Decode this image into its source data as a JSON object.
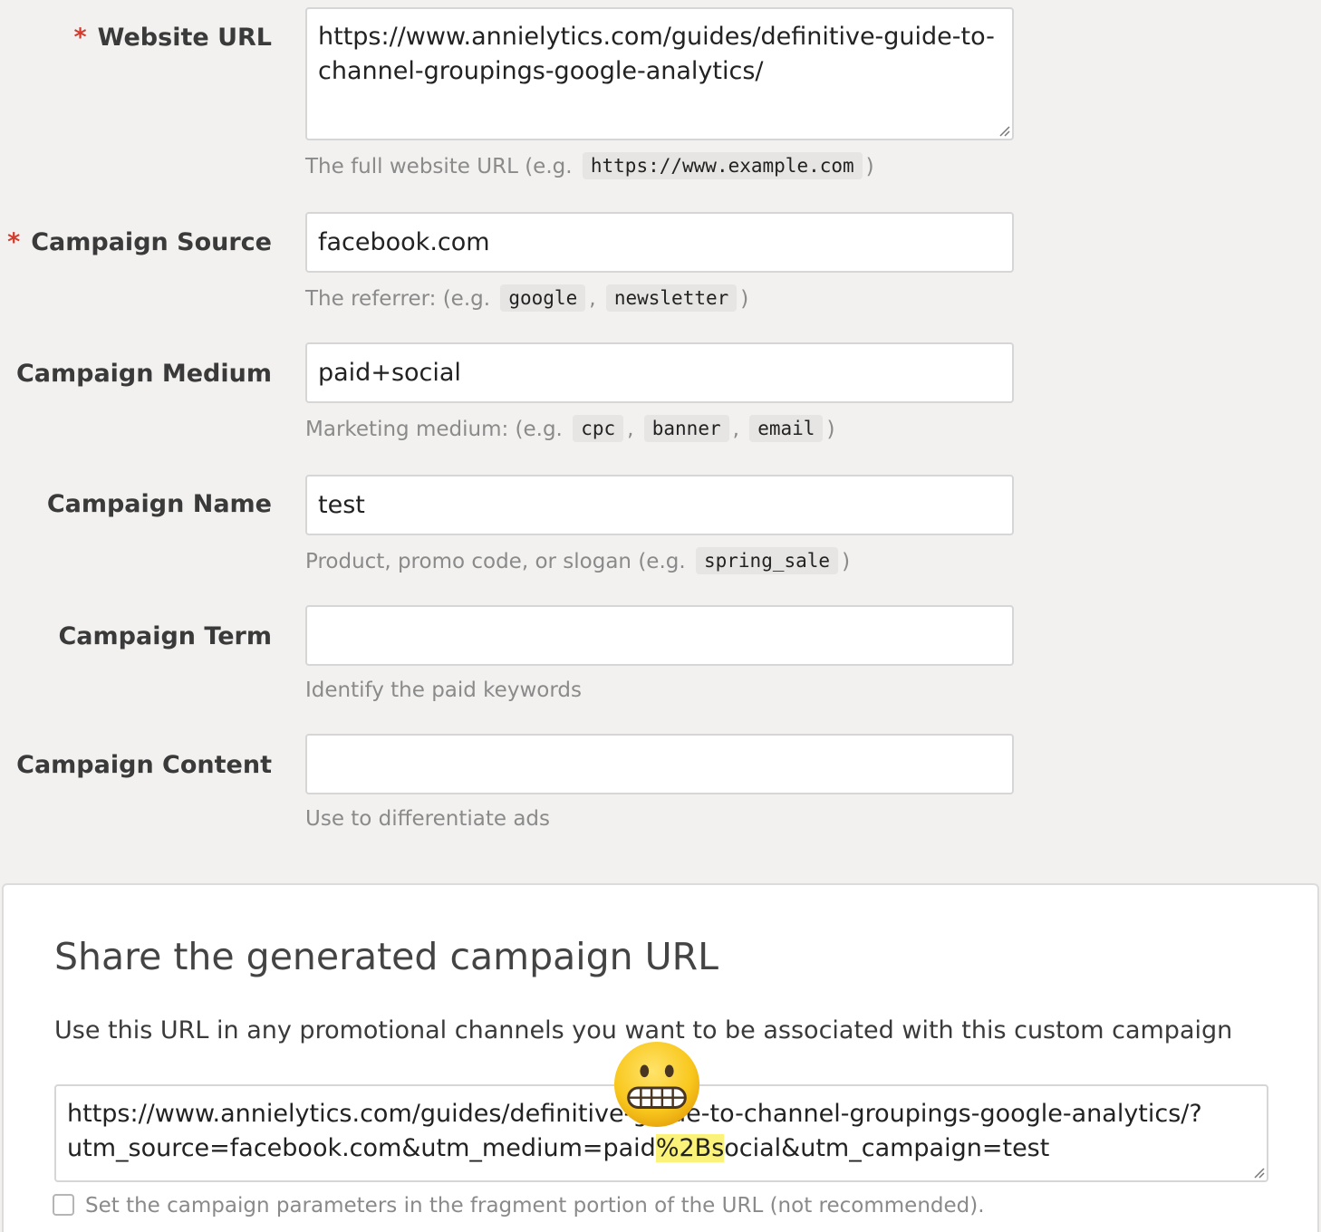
{
  "fields": {
    "website_url": {
      "label": "Website URL",
      "required_mark": "*",
      "value_line1": "https://www.annielytics.com/guides/definitive-guide-to-",
      "value_line2": "channel-groupings-google-analytics/",
      "help_prefix": "The full website URL (e.g.",
      "help_code": "https://www.example.com",
      "help_suffix": ")"
    },
    "campaign_source": {
      "label": "Campaign Source",
      "required_mark": "*",
      "value": "facebook.com",
      "help_prefix": "The referrer: (e.g.",
      "help_codes": [
        "google",
        "newsletter"
      ],
      "separator": ",",
      "help_suffix": ")"
    },
    "campaign_medium": {
      "label": "Campaign Medium",
      "value": "paid+social",
      "help_prefix": "Marketing medium: (e.g.",
      "help_codes": [
        "cpc",
        "banner",
        "email"
      ],
      "separator": ",",
      "help_suffix": ")"
    },
    "campaign_name": {
      "label": "Campaign Name",
      "value": "test",
      "help_prefix": "Product, promo code, or slogan (e.g.",
      "help_code": "spring_sale",
      "help_suffix": ")"
    },
    "campaign_term": {
      "label": "Campaign Term",
      "value": "",
      "help": "Identify the paid keywords"
    },
    "campaign_content": {
      "label": "Campaign Content",
      "value": "",
      "help": "Use to differentiate ads"
    }
  },
  "share": {
    "title": "Share the generated campaign URL",
    "description": "Use this URL in any promotional channels you want to be associated with this custom campaign",
    "url_line1": "https://www.annielytics.com/guides/definitive-guide-to-channel-groupings-google-analytics/?",
    "url_line2_pre": "utm_source=facebook.com&utm_medium=paid",
    "url_line2_highlight": "%2B",
    "url_line2_hl_tail": "s",
    "url_line2_post": "ocial&utm_campaign=test",
    "fragment_checkbox_label": "Set the campaign parameters in the fragment portion of the URL (not recommended).",
    "fragment_checked": false
  },
  "icons": {
    "annotation_emoji": "grimacing-face-icon",
    "resize_grip": "resize-grip-icon"
  },
  "colors": {
    "required": "#d33b2c",
    "highlight": "#fbf27a",
    "background": "#f2f1ef"
  }
}
